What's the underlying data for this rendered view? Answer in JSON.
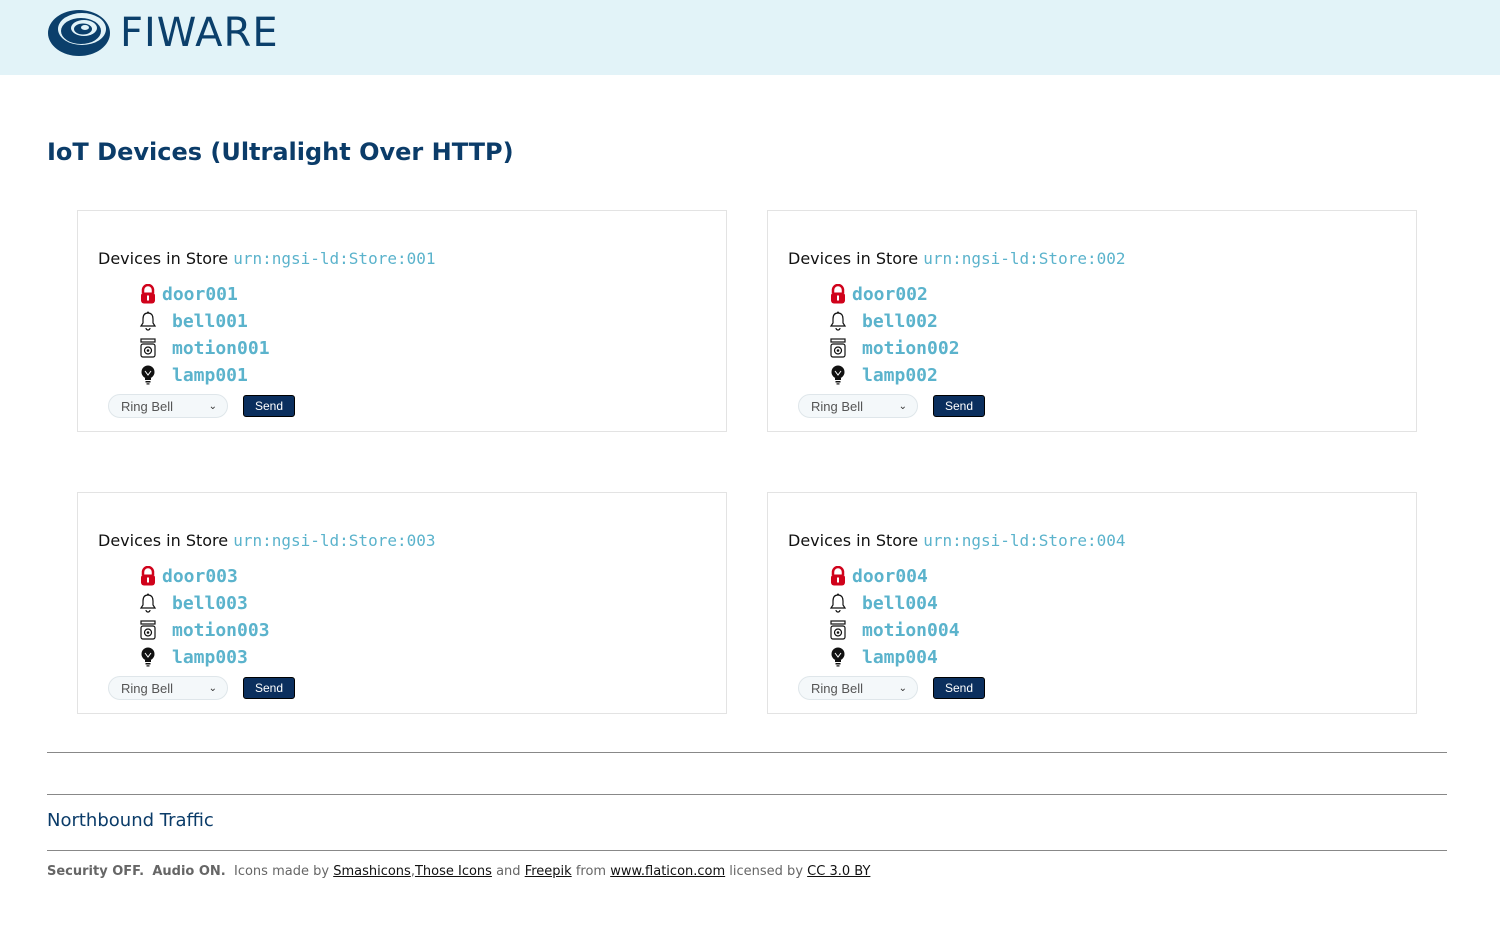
{
  "header": {
    "logo_text": "FIWARE"
  },
  "page_title": "IoT Devices (Ultralight Over HTTP)",
  "card_title_prefix": "Devices in Store",
  "stores": [
    {
      "urn": "urn:ngsi-ld:Store:001",
      "door": "door001",
      "bell": "bell001",
      "motion": "motion001",
      "lamp": "lamp001",
      "command": "Ring Bell",
      "send": "Send"
    },
    {
      "urn": "urn:ngsi-ld:Store:002",
      "door": "door002",
      "bell": "bell002",
      "motion": "motion002",
      "lamp": "lamp002",
      "command": "Ring Bell",
      "send": "Send"
    },
    {
      "urn": "urn:ngsi-ld:Store:003",
      "door": "door003",
      "bell": "bell003",
      "motion": "motion003",
      "lamp": "lamp003",
      "command": "Ring Bell",
      "send": "Send"
    },
    {
      "urn": "urn:ngsi-ld:Store:004",
      "door": "door004",
      "bell": "bell004",
      "motion": "motion004",
      "lamp": "lamp004",
      "command": "Ring Bell",
      "send": "Send"
    }
  ],
  "northbound": "Northbound Traffic",
  "footer": {
    "security": "Security OFF.",
    "audio": "Audio ON.",
    "icons_made_by": "Icons made by",
    "link_smashicons": "Smashicons",
    "link_those_icons": "Those Icons",
    "and": "and",
    "link_freepik": "Freepik",
    "from": "from",
    "link_flaticon": "www.flaticon.com",
    "licensed_by": "licensed by",
    "link_cc": "CC 3.0 BY"
  },
  "colors": {
    "accent": "#5bb3cc",
    "navy": "#0b3c69",
    "lock_red": "#d0021b",
    "header_bg": "#e2f3f8"
  }
}
